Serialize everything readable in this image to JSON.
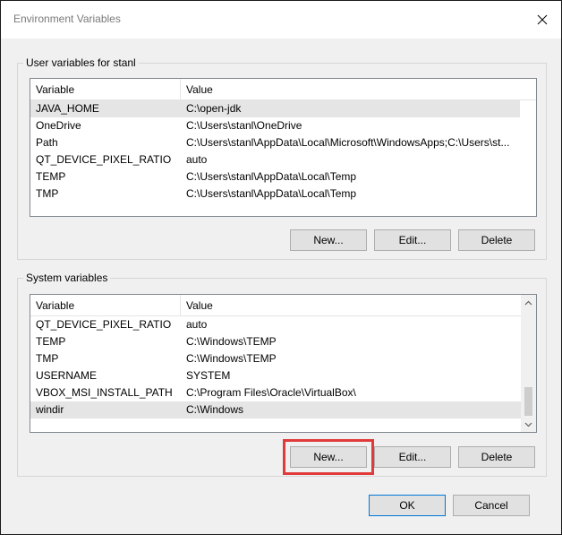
{
  "window": {
    "title": "Environment Variables"
  },
  "user_group": {
    "label": "User variables for stanl",
    "columns": {
      "variable": "Variable",
      "value": "Value"
    },
    "rows": [
      {
        "variable": "JAVA_HOME",
        "value": "C:\\open-jdk"
      },
      {
        "variable": "OneDrive",
        "value": "C:\\Users\\stanl\\OneDrive"
      },
      {
        "variable": "Path",
        "value": "C:\\Users\\stanl\\AppData\\Local\\Microsoft\\WindowsApps;C:\\Users\\st..."
      },
      {
        "variable": "QT_DEVICE_PIXEL_RATIO",
        "value": "auto"
      },
      {
        "variable": "TEMP",
        "value": "C:\\Users\\stanl\\AppData\\Local\\Temp"
      },
      {
        "variable": "TMP",
        "value": "C:\\Users\\stanl\\AppData\\Local\\Temp"
      }
    ],
    "buttons": {
      "new": "New...",
      "edit": "Edit...",
      "delete": "Delete"
    }
  },
  "system_group": {
    "label": "System variables",
    "columns": {
      "variable": "Variable",
      "value": "Value"
    },
    "rows": [
      {
        "variable": "QT_DEVICE_PIXEL_RATIO",
        "value": "auto"
      },
      {
        "variable": "TEMP",
        "value": "C:\\Windows\\TEMP"
      },
      {
        "variable": "TMP",
        "value": "C:\\Windows\\TEMP"
      },
      {
        "variable": "USERNAME",
        "value": "SYSTEM"
      },
      {
        "variable": "VBOX_MSI_INSTALL_PATH",
        "value": "C:\\Program Files\\Oracle\\VirtualBox\\"
      },
      {
        "variable": "windir",
        "value": "C:\\Windows"
      }
    ],
    "buttons": {
      "new": "New...",
      "edit": "Edit...",
      "delete": "Delete"
    }
  },
  "footer": {
    "ok": "OK",
    "cancel": "Cancel"
  },
  "colors": {
    "highlight_outline": "#e03a3a",
    "selected_row": "#e5e5e5",
    "window_bg": "#f0f0f0"
  }
}
